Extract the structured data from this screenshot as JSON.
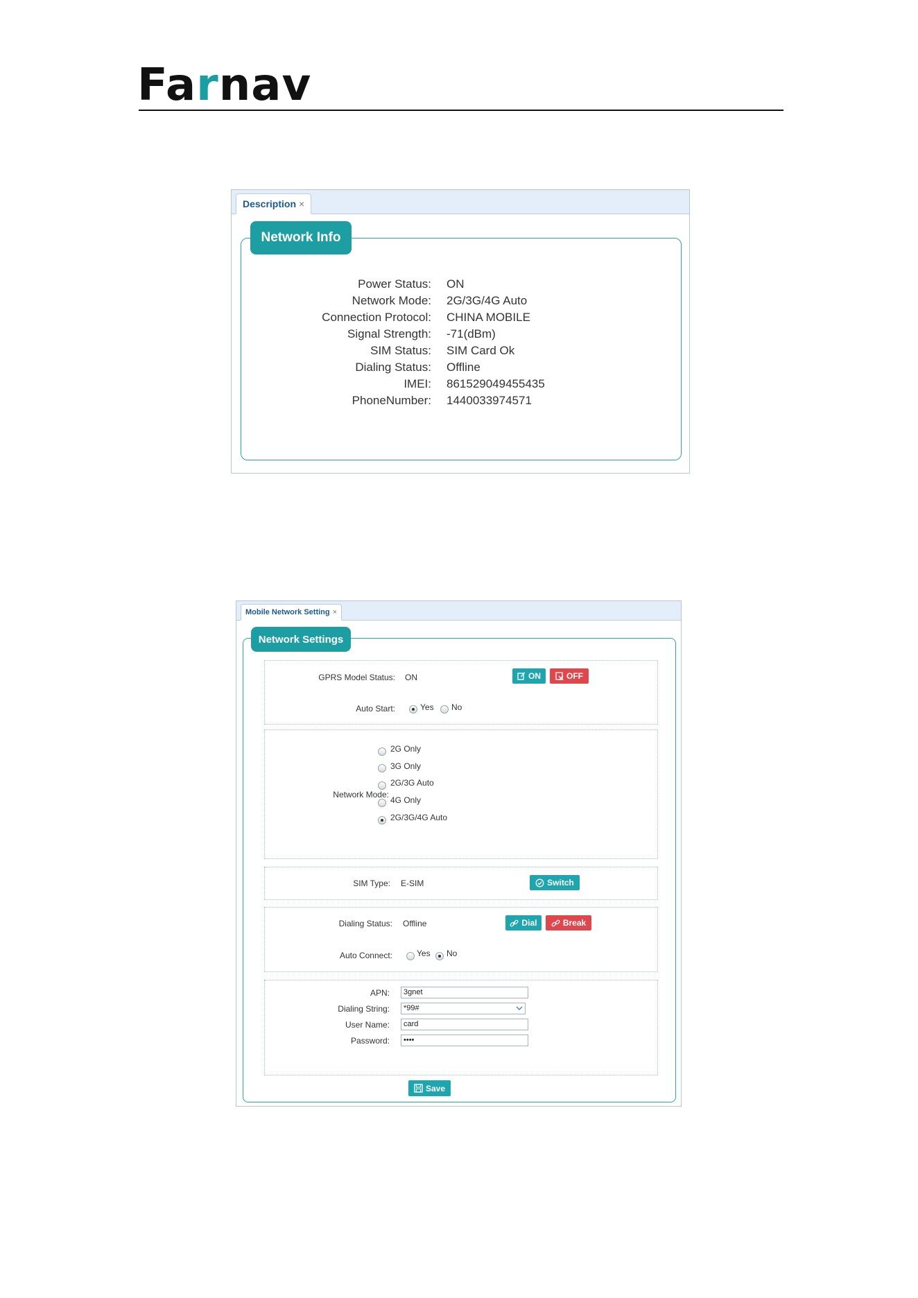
{
  "brand": {
    "logo_text_left": "Fa",
    "logo_text_accent": "r",
    "logo_text_right": "nav"
  },
  "colors": {
    "accent": "#1c9ea3",
    "danger": "#e0474c",
    "tab_bg": "#e3eefa",
    "border": "#2aa6aa"
  },
  "info_panel": {
    "tab_label": "Description",
    "tab_close": "×",
    "legend": "Network Info",
    "rows": [
      {
        "label": "Power Status:",
        "value": "ON"
      },
      {
        "label": "Network Mode:",
        "value": "2G/3G/4G Auto"
      },
      {
        "label": "Connection Protocol:",
        "value": "CHINA MOBILE"
      },
      {
        "label": "Signal Strength:",
        "value": "-71(dBm)"
      },
      {
        "label": "SIM Status:",
        "value": "SIM Card Ok"
      },
      {
        "label": "Dialing Status:",
        "value": "Offline"
      },
      {
        "label": "IMEI:",
        "value": "861529049455435"
      },
      {
        "label": "PhoneNumber:",
        "value": "1440033974571"
      }
    ]
  },
  "settings_panel": {
    "tab_label": "Mobile Network Setting",
    "tab_close": "×",
    "legend": "Network Settings",
    "gprs": {
      "label": "GPRS Model Status:",
      "value": "ON",
      "on_button": "ON",
      "off_button": "OFF",
      "auto_start_label": "Auto Start:",
      "auto_start_yes": "Yes",
      "auto_start_no": "No",
      "auto_start_selected": "Yes"
    },
    "network_mode": {
      "label": "Network Mode:",
      "options": [
        "2G Only",
        "3G Only",
        "2G/3G Auto",
        "4G Only",
        "2G/3G/4G Auto"
      ],
      "selected": "2G/3G/4G Auto"
    },
    "sim": {
      "label": "SIM Type:",
      "value": "E-SIM",
      "switch_button": "Switch"
    },
    "dialing": {
      "label": "Dialing Status:",
      "value": "Offline",
      "dial_button": "Dial",
      "break_button": "Break",
      "auto_connect_label": "Auto Connect:",
      "auto_connect_yes": "Yes",
      "auto_connect_no": "No",
      "auto_connect_selected": "No"
    },
    "connection": {
      "apn_label": "APN:",
      "apn_value": "3gnet",
      "dialing_string_label": "Dialing String:",
      "dialing_string_value": "*99#",
      "username_label": "User Name:",
      "username_value": "card",
      "password_label": "Password:",
      "password_value": "••••"
    },
    "save_button": "Save"
  }
}
